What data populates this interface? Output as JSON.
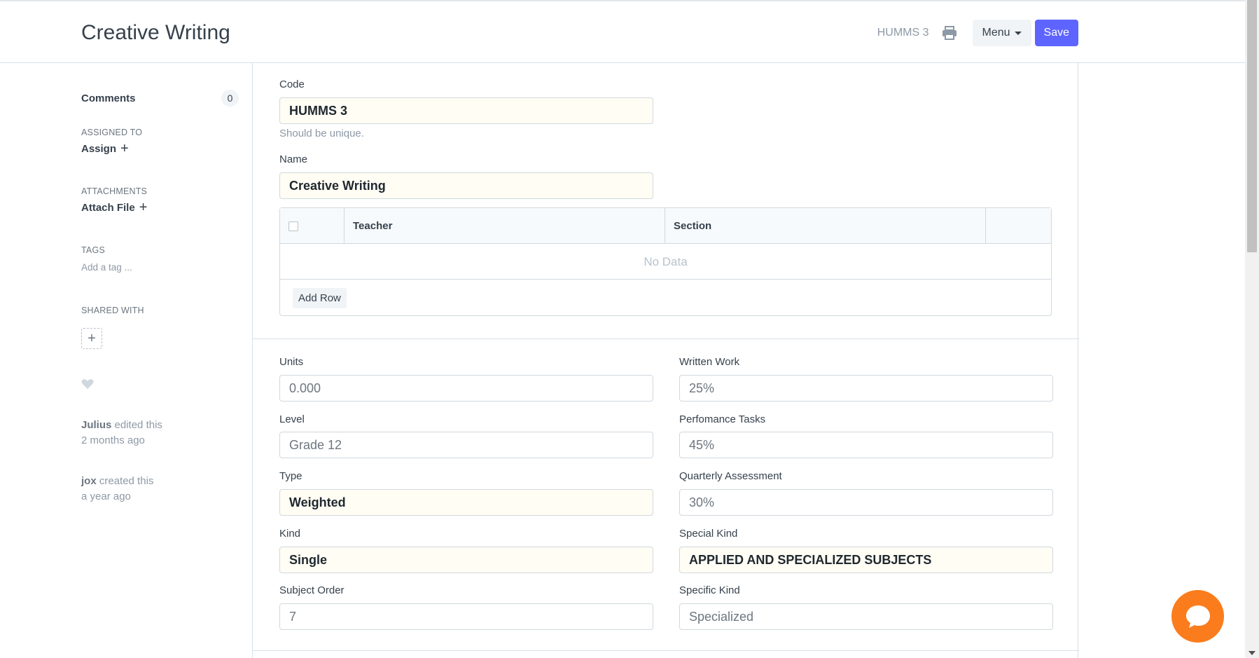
{
  "header": {
    "title": "Creative Writing",
    "doc_code": "HUMMS 3",
    "menu_label": "Menu",
    "save_label": "Save"
  },
  "sidebar": {
    "comments_label": "Comments",
    "comments_count": "0",
    "assigned_to_label": "ASSIGNED TO",
    "assign_label": "Assign",
    "attachments_label": "ATTACHMENTS",
    "attach_label": "Attach File",
    "tags_label": "TAGS",
    "add_tag_placeholder": "Add a tag ...",
    "shared_with_label": "SHARED WITH",
    "activity": [
      {
        "user": "Julius",
        "action": "edited this",
        "time": "2 months ago"
      },
      {
        "user": "jox",
        "action": "created this",
        "time": "a year ago"
      }
    ]
  },
  "form": {
    "code": {
      "label": "Code",
      "value": "HUMMS 3",
      "help": "Should be unique."
    },
    "name": {
      "label": "Name",
      "value": "Creative Writing"
    },
    "grid": {
      "columns": [
        "Teacher",
        "Section"
      ],
      "empty_text": "No Data",
      "add_row_label": "Add Row"
    },
    "units": {
      "label": "Units",
      "value": "0.000"
    },
    "level": {
      "label": "Level",
      "value": "Grade 12"
    },
    "type": {
      "label": "Type",
      "value": "Weighted"
    },
    "kind": {
      "label": "Kind",
      "value": "Single"
    },
    "subject_order": {
      "label": "Subject Order",
      "value": "7"
    },
    "written_work": {
      "label": "Written Work",
      "value": "25%"
    },
    "performance_tasks": {
      "label": "Perfomance Tasks",
      "value": "45%"
    },
    "quarterly_assessment": {
      "label": "Quarterly Assessment",
      "value": "30%"
    },
    "special_kind": {
      "label": "Special Kind",
      "value": "APPLIED AND SPECIALIZED SUBJECTS"
    },
    "specific_kind": {
      "label": "Specific Kind",
      "value": "Specialized"
    }
  },
  "icons": {
    "print": "printer-icon",
    "caret": "caret-down-icon",
    "heart": "heart-icon",
    "chat": "chat-bubble-icon"
  },
  "colors": {
    "primary": "#5e64ff",
    "required_field_bg": "#fffdf4",
    "chat_widget": "#fb7c1c"
  }
}
